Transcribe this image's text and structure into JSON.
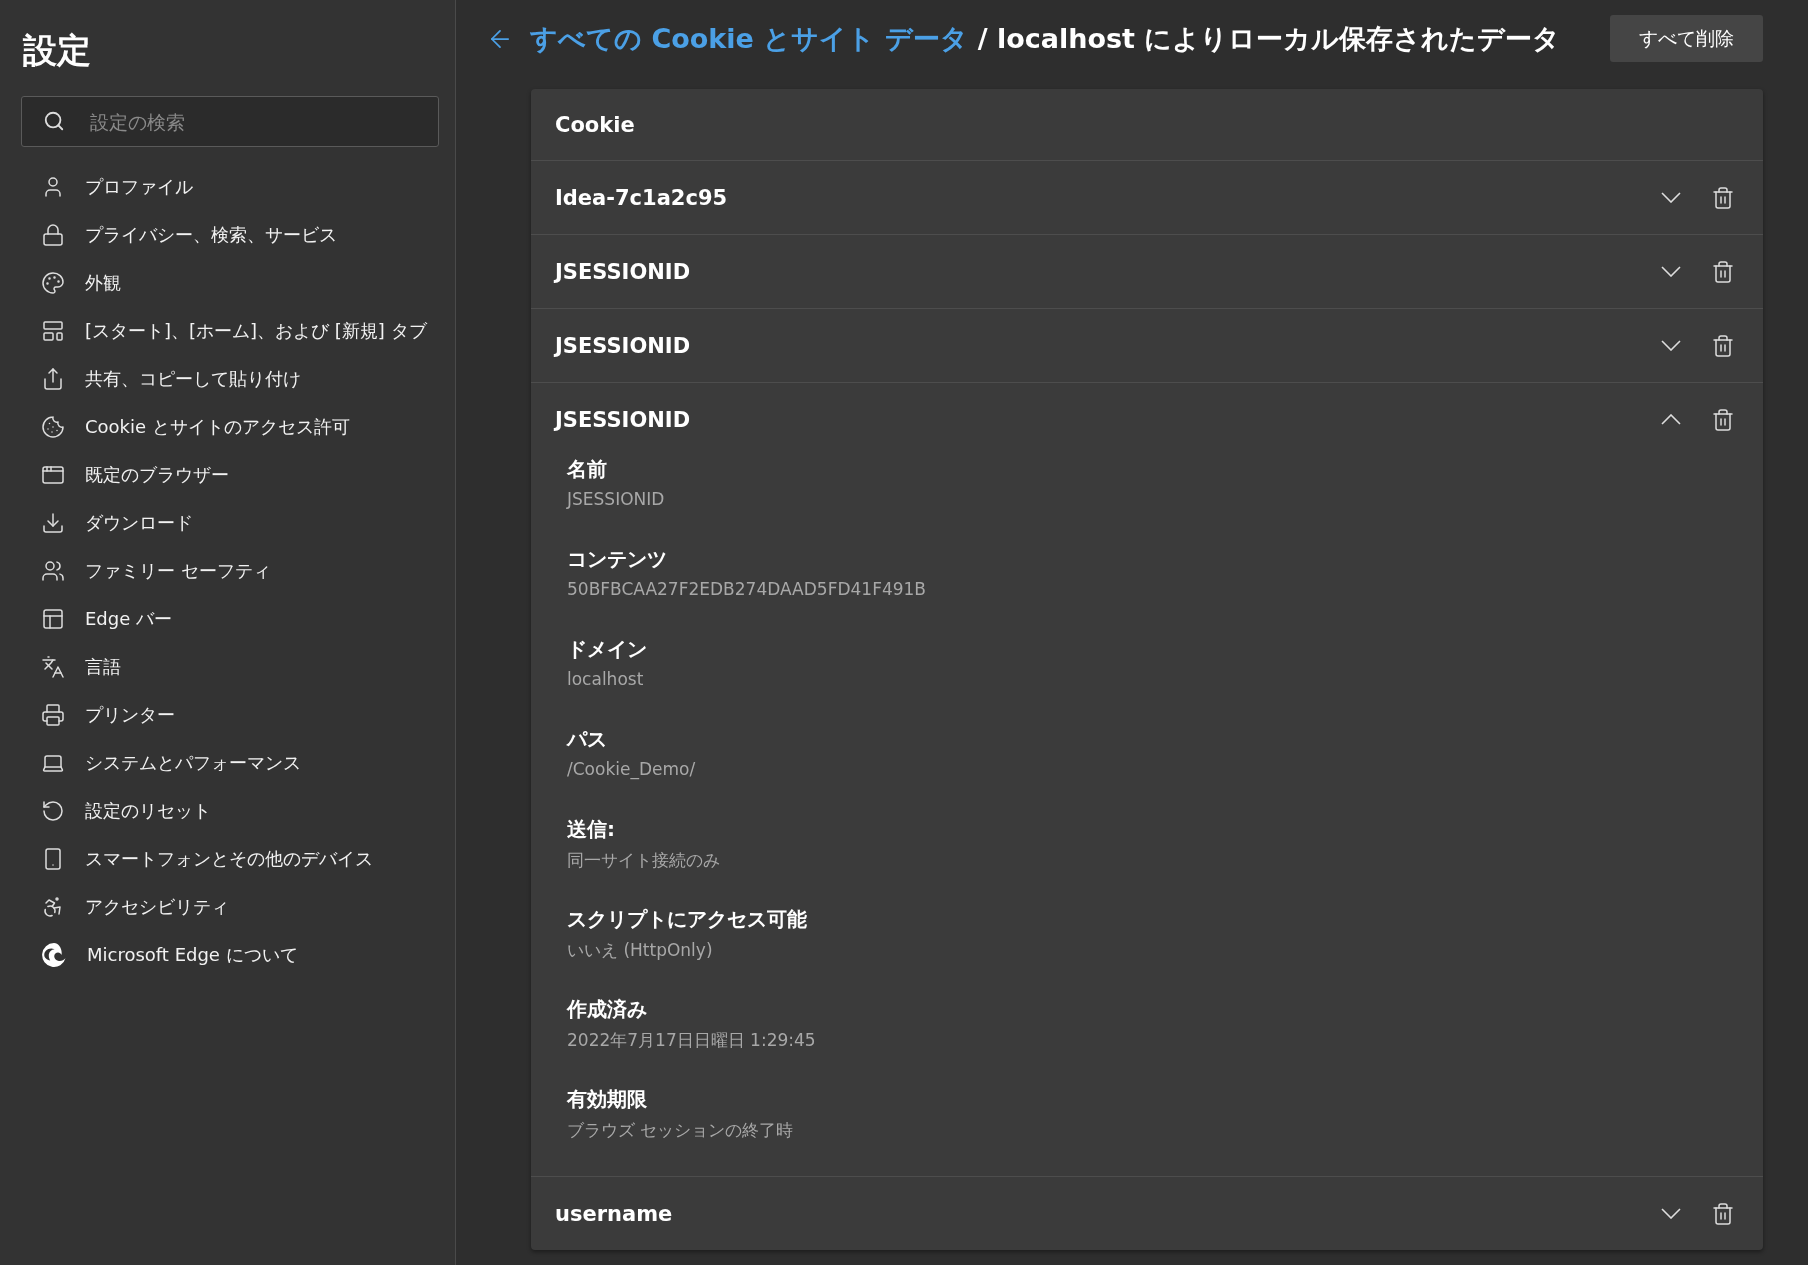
{
  "sidebar": {
    "title": "設定",
    "search": {
      "placeholder": "設定の検索"
    },
    "items": [
      {
        "label": "プロファイル"
      },
      {
        "label": "プライバシー、検索、サービス"
      },
      {
        "label": "外観"
      },
      {
        "label": "[スタート]、[ホーム]、および [新規] タブ"
      },
      {
        "label": "共有、コピーして貼り付け"
      },
      {
        "label": "Cookie とサイトのアクセス許可"
      },
      {
        "label": "既定のブラウザー"
      },
      {
        "label": "ダウンロード"
      },
      {
        "label": "ファミリー セーフティ"
      },
      {
        "label": "Edge バー"
      },
      {
        "label": "言語"
      },
      {
        "label": "プリンター"
      },
      {
        "label": "システムとパフォーマンス"
      },
      {
        "label": "設定のリセット"
      },
      {
        "label": "スマートフォンとその他のデバイス"
      },
      {
        "label": "アクセシビリティ"
      },
      {
        "label": "Microsoft Edge について"
      }
    ]
  },
  "header": {
    "breadcrumb_link": "すべての Cookie とサイト データ",
    "breadcrumb_current": "/ localhost によりローカル保存されたデータ",
    "delete_all_button": "すべて削除"
  },
  "card": {
    "title": "Cookie",
    "cookies": [
      {
        "name": "Idea-7c1a2c95",
        "expanded": false
      },
      {
        "name": "JSESSIONID",
        "expanded": false
      },
      {
        "name": "JSESSIONID",
        "expanded": false
      },
      {
        "name": "JSESSIONID",
        "expanded": true,
        "details": [
          {
            "label": "名前",
            "value": "JSESSIONID"
          },
          {
            "label": "コンテンツ",
            "value": "50BFBCAA27F2EDB274DAAD5FD41F491B"
          },
          {
            "label": "ドメイン",
            "value": "localhost"
          },
          {
            "label": "パス",
            "value": "/Cookie_Demo/"
          },
          {
            "label": "送信:",
            "value": "同一サイト接続のみ"
          },
          {
            "label": "スクリプトにアクセス可能",
            "value": "いいえ (HttpOnly)"
          },
          {
            "label": "作成済み",
            "value": "2022年7月17日日曜日 1:29:45"
          },
          {
            "label": "有効期限",
            "value": "ブラウズ セッションの終了時"
          }
        ]
      },
      {
        "name": "username",
        "expanded": false
      }
    ]
  }
}
